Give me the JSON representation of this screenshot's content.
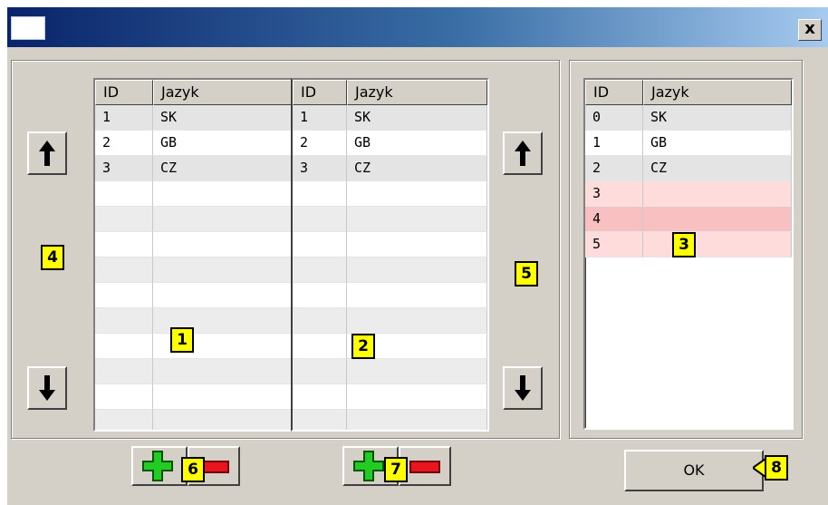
{
  "window": {
    "title": "",
    "close_label": "x"
  },
  "grid1": {
    "columns": [
      "ID",
      "Jazyk"
    ],
    "rows": [
      [
        "1",
        "SK"
      ],
      [
        "2",
        "GB"
      ],
      [
        "3",
        "CZ"
      ],
      [
        "",
        ""
      ],
      [
        "",
        ""
      ],
      [
        "",
        ""
      ],
      [
        "",
        ""
      ],
      [
        "",
        ""
      ],
      [
        "",
        ""
      ],
      [
        "",
        ""
      ],
      [
        "",
        ""
      ],
      [
        "",
        ""
      ],
      [
        "",
        ""
      ]
    ]
  },
  "grid2": {
    "columns": [
      "ID",
      "Jazyk"
    ],
    "rows": [
      [
        "1",
        "SK"
      ],
      [
        "2",
        "GB"
      ],
      [
        "3",
        "CZ"
      ],
      [
        "",
        ""
      ],
      [
        "",
        ""
      ],
      [
        "",
        ""
      ],
      [
        "",
        ""
      ],
      [
        "",
        ""
      ],
      [
        "",
        ""
      ],
      [
        "",
        ""
      ],
      [
        "",
        ""
      ],
      [
        "",
        ""
      ],
      [
        "",
        ""
      ]
    ]
  },
  "grid3": {
    "columns": [
      "ID",
      "Jazyk"
    ],
    "rows": [
      [
        "0",
        "SK"
      ],
      [
        "1",
        "GB"
      ],
      [
        "2",
        "CZ"
      ],
      [
        "3",
        ""
      ],
      [
        "4",
        ""
      ],
      [
        "5",
        ""
      ]
    ]
  },
  "badges": [
    "1",
    "2",
    "3",
    "4",
    "5",
    "6",
    "7",
    "8"
  ],
  "buttons": {
    "ok_label": "OK"
  },
  "colors": {
    "highlight_row": "#ffdcdc",
    "selected_row": "#f8c0c0",
    "badge": "#ffff00"
  }
}
